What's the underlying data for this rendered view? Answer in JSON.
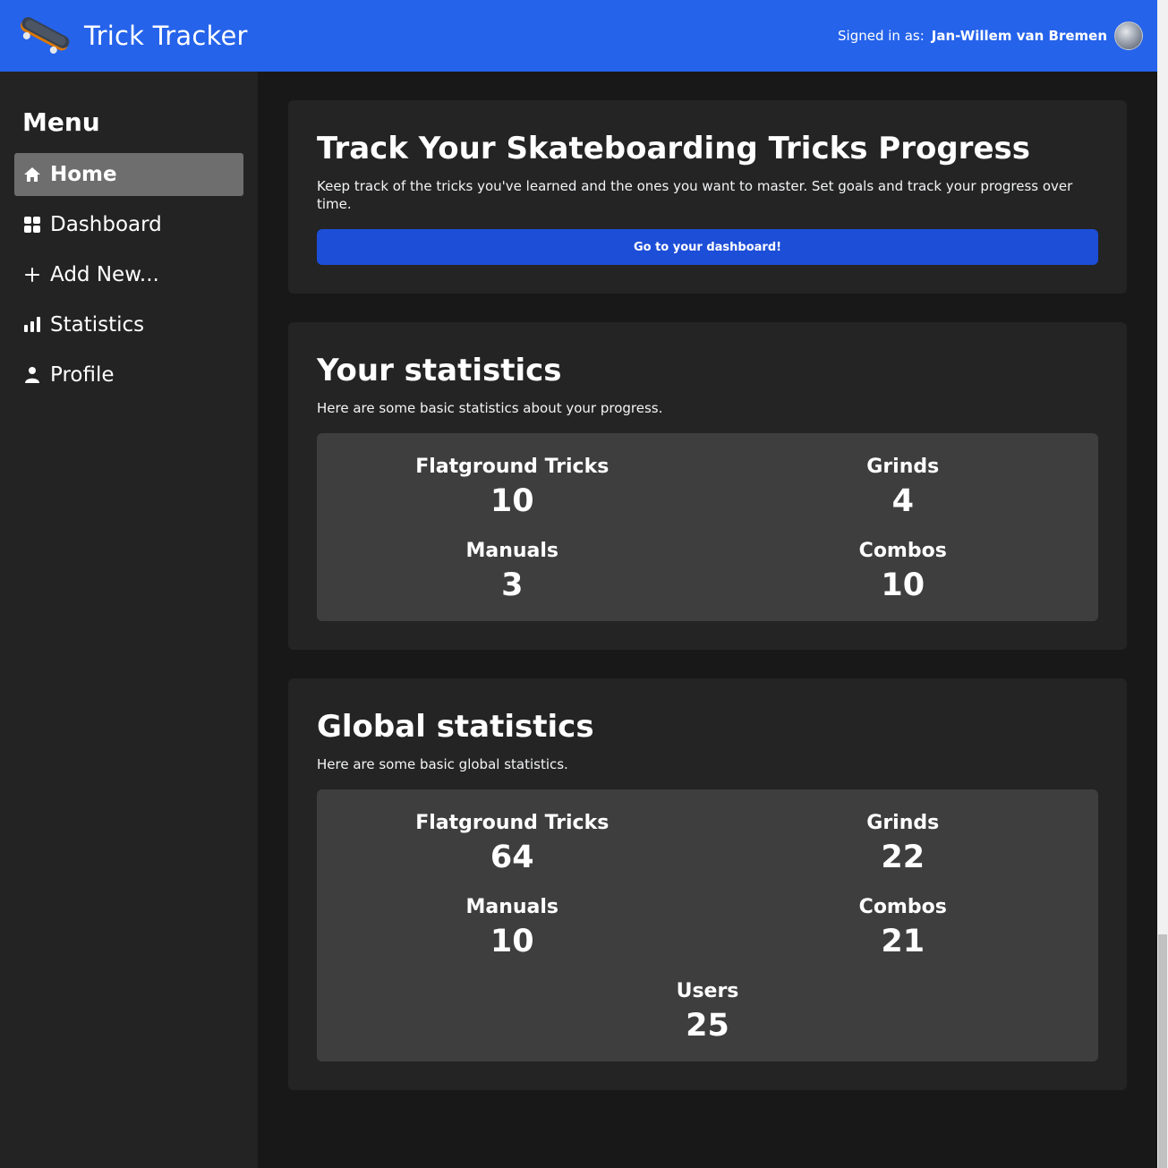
{
  "header": {
    "app_name": "Trick Tracker",
    "signed_in_prefix": "Signed in as:",
    "user_name": "Jan-Willem van Bremen",
    "brand_color": "#2563eb"
  },
  "sidebar": {
    "title": "Menu",
    "items": [
      {
        "label": "Home",
        "icon": "home-icon",
        "active": true
      },
      {
        "label": "Dashboard",
        "icon": "grid-icon",
        "active": false
      },
      {
        "label": "Add New...",
        "icon": "plus-icon",
        "active": false
      },
      {
        "label": "Statistics",
        "icon": "bar-chart-icon",
        "active": false
      },
      {
        "label": "Profile",
        "icon": "user-icon",
        "active": false
      }
    ]
  },
  "hero": {
    "title": "Track Your Skateboarding Tricks Progress",
    "description": "Keep track of the tricks you've learned and the ones you want to master. Set goals and track your progress over time.",
    "button_label": "Go to your dashboard!"
  },
  "your_stats": {
    "title": "Your statistics",
    "description": "Here are some basic statistics about your progress.",
    "items": [
      {
        "label": "Flatground Tricks",
        "value": "10"
      },
      {
        "label": "Grinds",
        "value": "4"
      },
      {
        "label": "Manuals",
        "value": "3"
      },
      {
        "label": "Combos",
        "value": "10"
      }
    ]
  },
  "global_stats": {
    "title": "Global statistics",
    "description": "Here are some basic global statistics.",
    "items": [
      {
        "label": "Flatground Tricks",
        "value": "64"
      },
      {
        "label": "Grinds",
        "value": "22"
      },
      {
        "label": "Manuals",
        "value": "10"
      },
      {
        "label": "Combos",
        "value": "21"
      },
      {
        "label": "Users",
        "value": "25"
      }
    ]
  }
}
